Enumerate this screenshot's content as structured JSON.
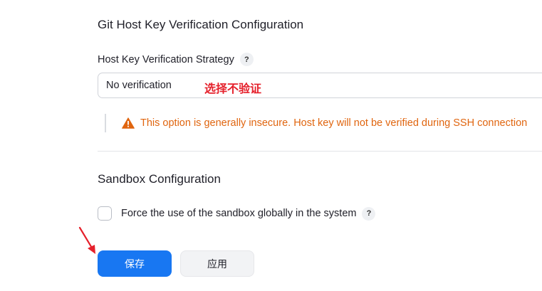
{
  "git_host_key": {
    "title": "Git Host Key Verification Configuration",
    "strategy_label": "Host Key Verification Strategy",
    "help": "?",
    "selected_strategy": "No verification",
    "annotation": "选择不验证",
    "warning_text": "This option is generally insecure. Host key will not be verified during SSH connection"
  },
  "sandbox": {
    "title": "Sandbox Configuration",
    "checkbox_label": "Force the use of the sandbox globally in the system",
    "checked": false,
    "help": "?"
  },
  "actions": {
    "save_label": "保存",
    "apply_label": "应用"
  },
  "colors": {
    "primary": "#1877f2",
    "warning": "#e0650f",
    "annotation": "#e5202b"
  },
  "icons": {
    "warning": "warning-triangle-icon",
    "annotation_arrow": "red-arrow-icon"
  }
}
